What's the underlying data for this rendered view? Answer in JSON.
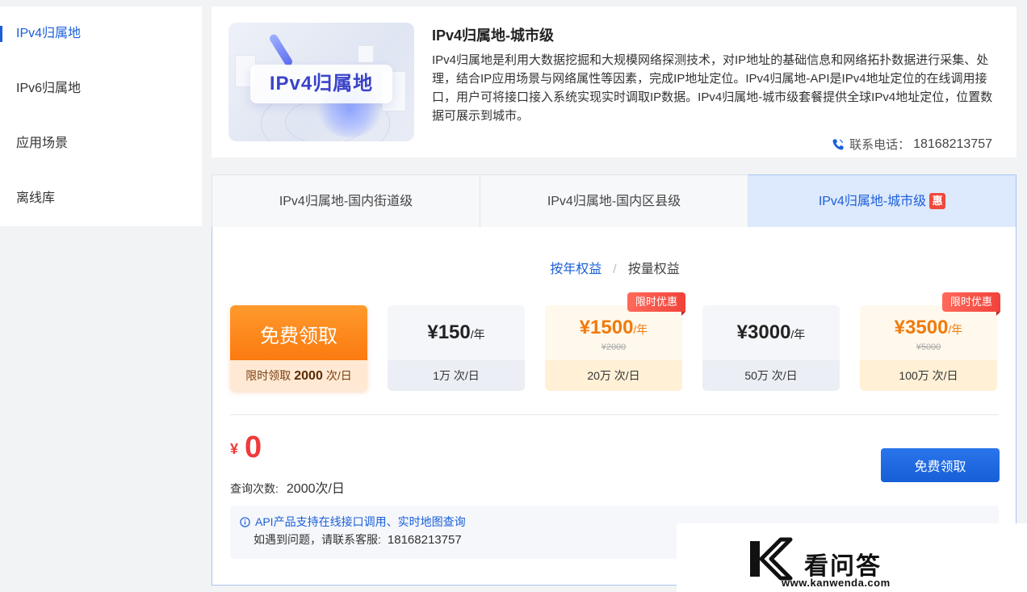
{
  "sidebar": {
    "items": [
      {
        "label": "IPv4归属地"
      },
      {
        "label": "IPv6归属地"
      },
      {
        "label": "应用场景"
      },
      {
        "label": "离线库"
      }
    ]
  },
  "product": {
    "banner_text": "IPv4归属地",
    "title": "IPv4归属地-城市级",
    "description": "IPv4归属地是利用大数据挖掘和大规模网络探测技术，对IP地址的基础信息和网络拓扑数据进行采集、处理，结合IP应用场景与网络属性等因素，完成IP地址定位。IPv4归属地-API是IPv4地址定位的在线调用接口，用户可将接口接入系统实现实时调取IP数据。IPv4归属地-城市级套餐提供全球IPv4地址定位，位置数据可展示到城市。",
    "contact_label": "联系电话：",
    "contact_value": "18168213757"
  },
  "tabs": [
    {
      "label": "IPv4归属地-国内街道级"
    },
    {
      "label": "IPv4归属地-国内区县级"
    },
    {
      "label": "IPv4归属地-城市级",
      "badge": "惠"
    }
  ],
  "mode": {
    "year": "按年权益",
    "sep": "/",
    "qty": "按量权益"
  },
  "plans": [
    {
      "title": "免费领取",
      "quota_prefix": "限时领取",
      "quota_value": "2000",
      "quota_suffix": "次/日"
    },
    {
      "price": "¥150",
      "unit": "/年",
      "quota": "1万 次/日"
    },
    {
      "price": "¥1500",
      "unit": "/年",
      "old_price": "¥2000",
      "quota": "20万 次/日",
      "tag": "限时优惠"
    },
    {
      "price": "¥3000",
      "unit": "/年",
      "quota": "50万 次/日"
    },
    {
      "price": "¥3500",
      "unit": "/年",
      "old_price": "¥5000",
      "quota": "100万 次/日",
      "tag": "限时优惠"
    }
  ],
  "order": {
    "currency": "¥",
    "amount": "0",
    "query_label": "查询次数:",
    "query_value": "2000次/日",
    "button": "免费领取"
  },
  "notice": {
    "line1": "API产品支持在线接口调用、实时地图查询",
    "line2_label": "如遇到问题，请联系客服:",
    "line2_value": "18168213757"
  },
  "watermark": {
    "cn": "看问答",
    "url": "www.kanwenda.com"
  },
  "colors": {
    "accent": "#1a5fd8",
    "orange": "#fb7a10",
    "price_hot": "#f07b0d",
    "red": "#f03a3a"
  }
}
